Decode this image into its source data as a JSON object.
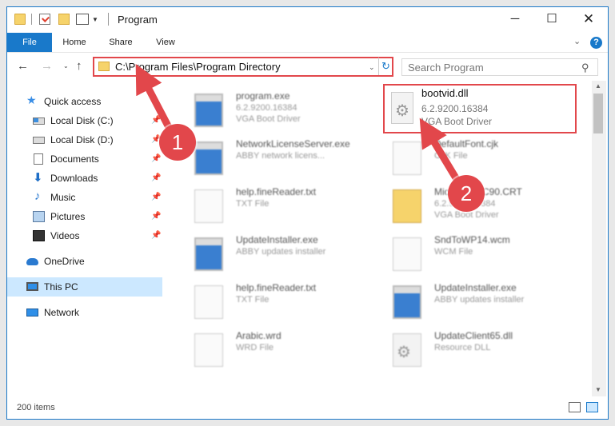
{
  "window": {
    "title": "Program"
  },
  "ribbon": {
    "file": "File",
    "home": "Home",
    "share": "Share",
    "view": "View"
  },
  "address": {
    "path": "C:\\Program Files\\Program Directory"
  },
  "search": {
    "placeholder": "Search Program"
  },
  "sidebar": {
    "items": [
      {
        "label": "Quick access",
        "icon": "star-icon",
        "pinned": false
      },
      {
        "label": "Local Disk (C:)",
        "icon": "disk-icon",
        "pinned": true
      },
      {
        "label": "Local Disk (D:)",
        "icon": "disk-icon",
        "pinned": true
      },
      {
        "label": "Documents",
        "icon": "documents-icon",
        "pinned": true
      },
      {
        "label": "Downloads",
        "icon": "downloads-icon",
        "pinned": true
      },
      {
        "label": "Music",
        "icon": "music-icon",
        "pinned": true
      },
      {
        "label": "Pictures",
        "icon": "pictures-icon",
        "pinned": true
      },
      {
        "label": "Videos",
        "icon": "videos-icon",
        "pinned": true
      },
      {
        "label": "OneDrive",
        "icon": "onedrive-icon",
        "pinned": false
      },
      {
        "label": "This PC",
        "icon": "this-pc-icon",
        "pinned": false,
        "selected": true
      },
      {
        "label": "Network",
        "icon": "network-icon",
        "pinned": false
      }
    ]
  },
  "files": [
    {
      "name": "program.exe",
      "line1": "6.2.9200.16384",
      "line2": "VGA Boot Driver",
      "icon": "exe-icon"
    },
    {
      "name": "NetworkLicenseServer.exe",
      "line1": "ABBY network licens...",
      "line2": "",
      "icon": "exe-icon"
    },
    {
      "name": "help.fineReader.txt",
      "line1": "TXT File",
      "line2": "",
      "icon": "text-file-icon"
    },
    {
      "name": "UpdateInstaller.exe",
      "line1": "ABBY updates installer",
      "line2": "",
      "icon": "exe-icon"
    },
    {
      "name": "help.fineReader.txt",
      "line1": "TXT File",
      "line2": "",
      "icon": "text-file-icon"
    },
    {
      "name": "Arabic.wrd",
      "line1": "WRD File",
      "line2": "",
      "icon": "text-file-icon"
    },
    {
      "name": "DefaultFont.cjk",
      "line1": "CJK File",
      "line2": "",
      "icon": "text-file-icon"
    },
    {
      "name": "Microsoft.VC90.CRT",
      "line1": "6.2.9200.16384",
      "line2": "VGA Boot Driver",
      "icon": "folder-file-icon"
    },
    {
      "name": "SndToWP14.wcm",
      "line1": "WCM File",
      "line2": "",
      "icon": "text-file-icon"
    },
    {
      "name": "UpdateInstaller.exe",
      "line1": "ABBY updates installer",
      "line2": "",
      "icon": "exe-icon"
    },
    {
      "name": "UpdateClient65.dll",
      "line1": "Resource DLL",
      "line2": "",
      "icon": "dll-icon"
    }
  ],
  "highlighted_file": {
    "name": "bootvid.dll",
    "line1": "6.2.9200.16384",
    "line2": "VGA Boot Driver",
    "icon": "dll-icon"
  },
  "status": {
    "items": "200 items"
  },
  "annotations": {
    "badge1": "1",
    "badge2": "2",
    "color": "#e2474b"
  }
}
